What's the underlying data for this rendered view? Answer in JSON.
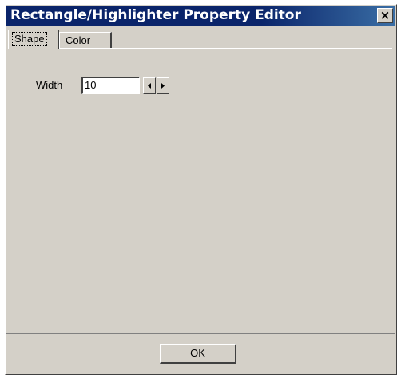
{
  "window": {
    "title": "Rectangle/Highlighter Property Editor",
    "close_label": "×"
  },
  "tabs": [
    {
      "label": "Shape",
      "active": true
    },
    {
      "label": "Color",
      "active": false
    }
  ],
  "shape_panel": {
    "width_label": "Width",
    "width_value": "10",
    "decrease_icon": "arrow-left-icon",
    "increase_icon": "arrow-right-icon"
  },
  "footer": {
    "ok_label": "OK"
  },
  "colors": {
    "titlebar": "#0a246a",
    "face": "#d4d0c8"
  }
}
